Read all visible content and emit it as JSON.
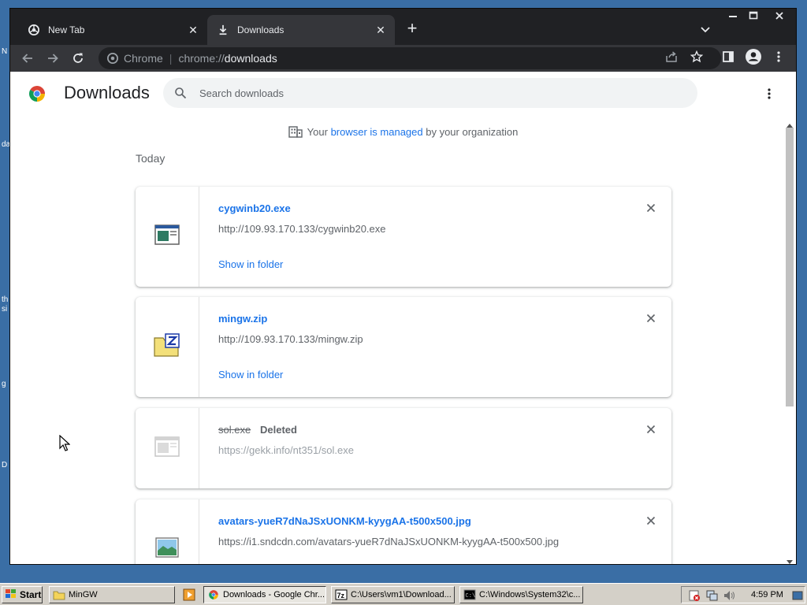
{
  "desktop": {
    "fragments": [
      "N",
      "da",
      "th",
      "si",
      "g",
      "D"
    ]
  },
  "browser": {
    "tabs": [
      {
        "title": "New Tab",
        "active": false
      },
      {
        "title": "Downloads",
        "active": true
      }
    ],
    "omnibox": {
      "chip": "Chrome",
      "url_scheme": "chrome://",
      "url_host": "downloads"
    }
  },
  "page": {
    "title": "Downloads",
    "search_placeholder": "Search downloads",
    "managed": {
      "prefix": "Your ",
      "link": "browser is managed",
      "suffix": " by your organization"
    },
    "section_date": "Today",
    "downloads": [
      {
        "file_name": "cygwinb20.exe",
        "url": "http://109.93.170.133/cygwinb20.exe",
        "action": "Show in folder",
        "status": "",
        "icon": "exe-file-icon"
      },
      {
        "file_name": "mingw.zip",
        "url": "http://109.93.170.133/mingw.zip",
        "action": "Show in folder",
        "status": "",
        "icon": "zip-file-icon"
      },
      {
        "file_name": "sol.exe",
        "url": "https://gekk.info/nt351/sol.exe",
        "action": "",
        "status": "Deleted",
        "icon": "exe-file-icon"
      },
      {
        "file_name": "avatars-yueR7dNaJSxUONKM-kyygAA-t500x500.jpg",
        "url": "https://i1.sndcdn.com/avatars-yueR7dNaJSxUONKM-kyygAA-t500x500.jpg",
        "action": "",
        "status": "",
        "icon": "image-file-icon"
      }
    ]
  },
  "taskbar": {
    "start_label": "Start",
    "tasks": [
      {
        "label": "MinGW",
        "active": false
      },
      {
        "label": "Downloads - Google Chr...",
        "active": true
      },
      {
        "label": "C:\\Users\\vm1\\Download...",
        "active": false
      },
      {
        "label": "C:\\Windows\\System32\\c...",
        "active": false
      }
    ],
    "clock": "4:59 PM"
  },
  "colors": {
    "link": "#1a73e8",
    "tab_bar": "#202124",
    "toolbar": "#35363a",
    "desktop": "#3a6ea5"
  }
}
